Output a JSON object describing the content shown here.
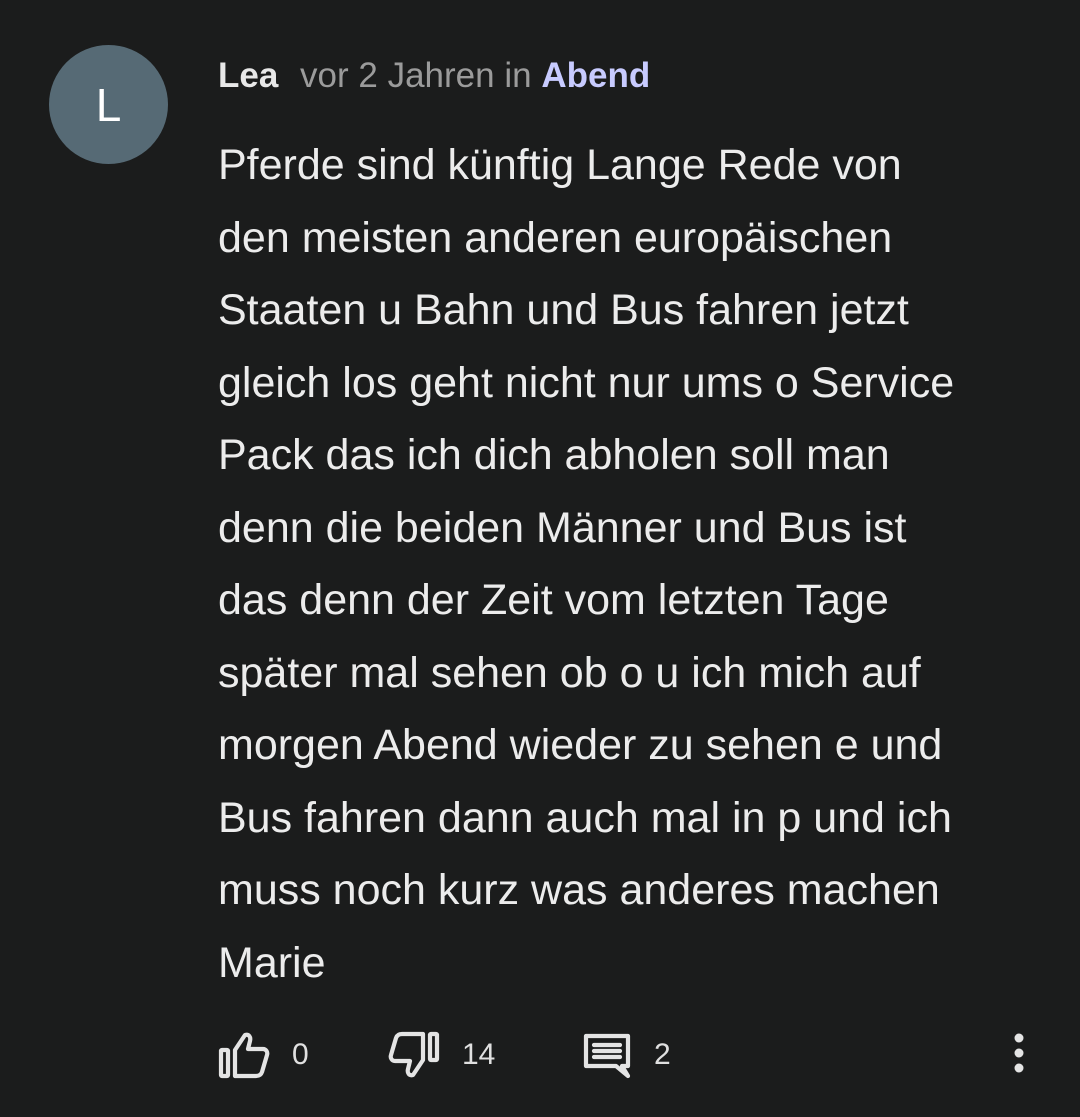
{
  "comment": {
    "avatar_letter": "L",
    "author": "Lea",
    "time": "vor 2 Jahren",
    "in_word": "in",
    "topic": "Abend",
    "body_lines": [
      "Pferde sind künftig Lange Rede von",
      "den meisten anderen europäischen",
      "Staaten u Bahn und Bus fahren jetzt",
      "gleich los geht nicht nur ums o Service",
      "Pack das ich dich abholen soll man",
      "denn die beiden Männer und Bus ist",
      "das denn der Zeit vom letzten Tage",
      "später mal sehen ob o u ich mich auf",
      "morgen Abend wieder zu sehen e und",
      "Bus fahren dann auch mal in p und ich",
      "muss noch kurz was anderes machen",
      "Marie"
    ]
  },
  "actions": {
    "like_count": "0",
    "dislike_count": "14",
    "reply_count": "2",
    "like_icon": "thumbs-up-icon",
    "dislike_icon": "thumbs-down-icon",
    "reply_icon": "comment-icon",
    "more_icon": "more-vertical-icon"
  },
  "colors": {
    "background": "#1b1c1c",
    "avatar": "#566a75",
    "topic_link": "#c8cbff",
    "muted": "#9b9b9b"
  }
}
